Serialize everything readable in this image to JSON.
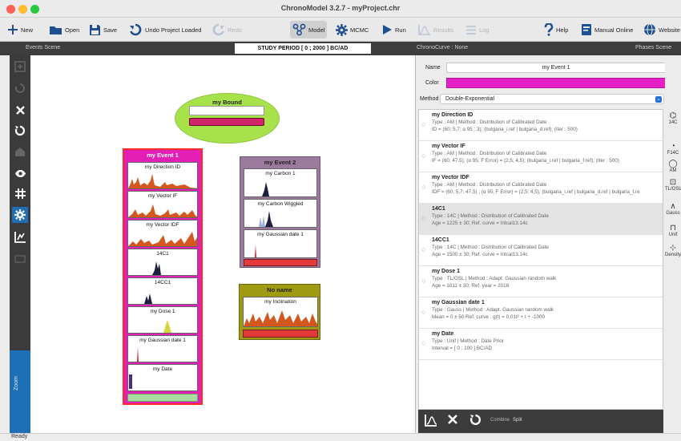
{
  "window": {
    "title": "ChronoModel 3.2.7 - myProject.chr"
  },
  "toolbar": {
    "new": "New",
    "open": "Open",
    "save": "Save",
    "undo": "Undo Project Loaded",
    "redo": "Redo",
    "model": "Model",
    "mcmc": "MCMC",
    "run": "Run",
    "results": "Results",
    "log": "Log",
    "help": "Help",
    "manual": "Manual Online",
    "website": "Website"
  },
  "band": {
    "events_scene": "Events Scene",
    "study_period": "STUDY PERIOD [ 0 ; 2000 ] BC/AD",
    "chronocurve": "ChronoCurve : None",
    "phases_scene": "Phases Scene"
  },
  "zoom_label": "Zoom",
  "bound": {
    "name": "my Bound"
  },
  "events": [
    {
      "name": "my Event 1",
      "dates": [
        "my Direction ID",
        "my Vector IF",
        "my Vector IDF",
        "14C1",
        "14CC1",
        "my Dose 1",
        "my Gaussian date 1",
        "my Date"
      ]
    },
    {
      "name": "my Event 2",
      "dates": [
        "my Carbon 1",
        "my Carbon Wiggled",
        "my Gaussian date 1"
      ]
    },
    {
      "name": "No name",
      "dates": [
        "my Inclination"
      ]
    }
  ],
  "colors": {
    "event1": "#e41fb6",
    "event2": "#9b7a9e",
    "event3": "#a09a12",
    "bound": "#a8e24a",
    "zoom": "#1e6fb3"
  },
  "panel": {
    "name_label": "Name",
    "name_value": "my Event 1",
    "color_label": "Color",
    "color_value": "#e41fc5",
    "method_label": "Method",
    "method_value": "Double-Exponential"
  },
  "dates_list": [
    {
      "title": "my Direction ID",
      "line1": "Type : AM | Method : Distribution of Calibrated Date",
      "line2": "ID = (60; 5,7; α 95 : 3); (bulgaria_i.ref | bulgaria_d.ref); (Iter : 500)"
    },
    {
      "title": "my Vector IF",
      "line1": "Type : AM | Method : Distribution of Calibrated Date",
      "line2": "IF = (60; 47,5); (α 95; F Error) = (2,5; 4,5); (bulgaria_i.ref | bulgaria_f.ref); (Iter : 500)"
    },
    {
      "title": "my Vector IDF",
      "line1": "Type : AM | Method : Distribution of Calibrated Date",
      "line2": "IDF = (60; 5,7; 47,5) ; (α 95; F Error) = (2,5; 4,5); (bulgaria_i.ref | bulgaria_d.ref | bulgaria_f.re"
    },
    {
      "title": "14C1",
      "line1": "Type : 14C | Method : Distribution of Calibrated Date",
      "line2": "Age = 1225  ± 30; Ref. curve = Intcal13.14c"
    },
    {
      "title": "14CC1",
      "line1": "Type : 14C | Method : Distribution of Calibrated Date",
      "line2": "Age = 1500  ± 30; Ref. curve = Intcal13.14c"
    },
    {
      "title": "my Dose 1",
      "line1": "Type : TL/OSL | Method : Adapt. Gaussian random walk",
      "line2": "Age = 1011  ± 30; Ref. year = 2016"
    },
    {
      "title": "my Gaussian date 1",
      "line1": "Type : Gauss | Method : Adapt. Gaussian random walk",
      "line2": "Mean = 0  ± 50 Ref. curve : g(t) = 0,01t² + t + -1000"
    },
    {
      "title": "my Date",
      "line1": "Type : Unif | Method : Date Prior",
      "line2": "Interval = [ 0 : 100 ] BC/AD"
    }
  ],
  "right_tools": [
    "14C",
    "F14C",
    "AM",
    "TL/OSL",
    "Gauss",
    "Unif",
    "Density"
  ],
  "bottom_tools": {
    "combine": "Combine",
    "split": "Split"
  },
  "status": "Ready"
}
